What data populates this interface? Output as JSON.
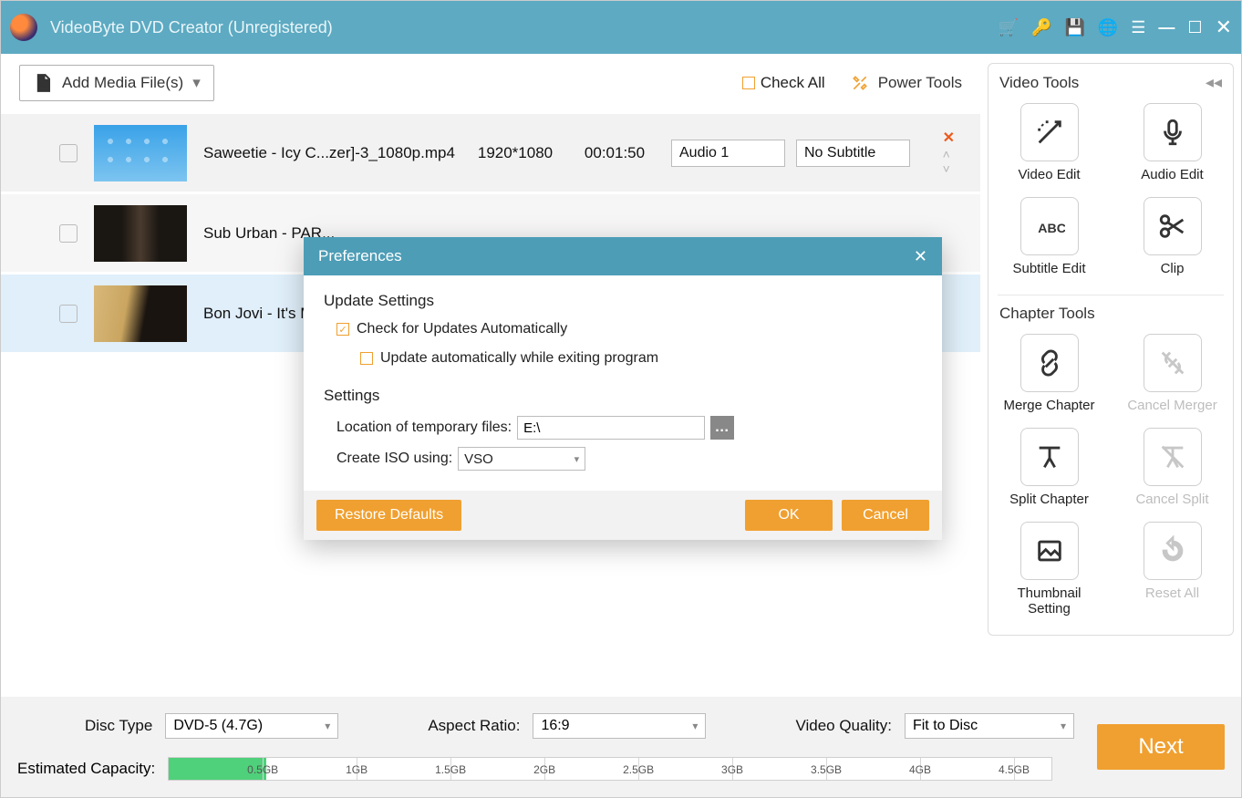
{
  "titlebar": {
    "title": "VideoByte DVD Creator (Unregistered)"
  },
  "toolbar": {
    "add_media": "Add Media File(s)",
    "check_all": "Check All",
    "power_tools": "Power Tools"
  },
  "rows": [
    {
      "title": "Saweetie - Icy C...zer]-3_1080p.mp4",
      "res": "1920*1080",
      "dur": "00:01:50",
      "audio": "Audio 1",
      "sub": "No Subtitle"
    },
    {
      "title": "Sub Urban - PAR..."
    },
    {
      "title": "Bon Jovi - It's My..."
    }
  ],
  "panel": {
    "video_title": "Video Tools",
    "chapter_title": "Chapter Tools",
    "tools": {
      "video_edit": "Video Edit",
      "audio_edit": "Audio Edit",
      "subtitle_edit": "Subtitle Edit",
      "clip": "Clip",
      "merge_chapter": "Merge Chapter",
      "cancel_merger": "Cancel Merger",
      "split_chapter": "Split Chapter",
      "cancel_split": "Cancel Split",
      "thumbnail_setting": "Thumbnail Setting",
      "reset_all": "Reset All"
    }
  },
  "bottom": {
    "disc_type_label": "Disc Type",
    "disc_type_value": "DVD-5 (4.7G)",
    "aspect_label": "Aspect Ratio:",
    "aspect_value": "16:9",
    "quality_label": "Video Quality:",
    "quality_value": "Fit to Disc",
    "est_label": "Estimated Capacity:",
    "ticks": [
      "0.5GB",
      "1GB",
      "1.5GB",
      "2GB",
      "2.5GB",
      "3GB",
      "3.5GB",
      "4GB",
      "4.5GB"
    ],
    "next": "Next"
  },
  "modal": {
    "title": "Preferences",
    "update_title": "Update Settings",
    "check_updates": "Check for Updates Automatically",
    "update_exit": "Update automatically while exiting program",
    "settings_title": "Settings",
    "loc_label": "Location of temporary files:",
    "loc_value": "E:\\",
    "iso_label": "Create ISO using:",
    "iso_value": "VSO",
    "restore": "Restore Defaults",
    "ok": "OK",
    "cancel": "Cancel"
  }
}
